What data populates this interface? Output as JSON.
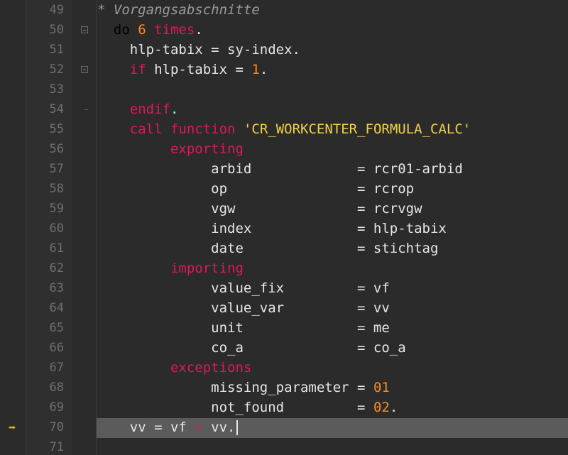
{
  "editor": {
    "current_line_arrow": "➡",
    "lines": [
      {
        "n": "49",
        "t": [
          {
            "c": "comment",
            "s": "* Vorgangsabschnitte"
          }
        ]
      },
      {
        "n": "50",
        "fold": "start",
        "t": [
          {
            "c": "plain",
            "s": "  "
          },
          {
            "c": "kw",
            "s": "do"
          },
          {
            "c": "plain",
            "s": " "
          },
          {
            "c": "num",
            "s": "6"
          },
          {
            "c": "plain",
            "s": " "
          },
          {
            "c": "kw2",
            "s": "times"
          },
          {
            "c": "plain",
            "s": "."
          }
        ]
      },
      {
        "n": "51",
        "t": [
          {
            "c": "plain",
            "s": "    hlp-tabix = sy-index."
          }
        ]
      },
      {
        "n": "52",
        "fold": "start",
        "t": [
          {
            "c": "plain",
            "s": "    "
          },
          {
            "c": "kw2",
            "s": "if"
          },
          {
            "c": "plain",
            "s": " hlp-tabix = "
          },
          {
            "c": "num",
            "s": "1"
          },
          {
            "c": "plain",
            "s": "."
          }
        ]
      },
      {
        "n": "53",
        "t": []
      },
      {
        "n": "54",
        "fold": "end",
        "t": [
          {
            "c": "plain",
            "s": "    "
          },
          {
            "c": "kw2",
            "s": "endif"
          },
          {
            "c": "plain",
            "s": "."
          }
        ]
      },
      {
        "n": "55",
        "t": [
          {
            "c": "plain",
            "s": "    "
          },
          {
            "c": "kw2",
            "s": "call function"
          },
          {
            "c": "plain",
            "s": " "
          },
          {
            "c": "str",
            "s": "'CR_WORKCENTER_FORMULA_CALC'"
          }
        ]
      },
      {
        "n": "56",
        "t": [
          {
            "c": "plain",
            "s": "         "
          },
          {
            "c": "kw2",
            "s": "exporting"
          }
        ]
      },
      {
        "n": "57",
        "t": [
          {
            "c": "plain",
            "s": "              arbid             = rcr01-arbid"
          }
        ]
      },
      {
        "n": "58",
        "t": [
          {
            "c": "plain",
            "s": "              op                = rcrop"
          }
        ]
      },
      {
        "n": "59",
        "t": [
          {
            "c": "plain",
            "s": "              vgw               = rcrvgw"
          }
        ]
      },
      {
        "n": "60",
        "t": [
          {
            "c": "plain",
            "s": "              index             = hlp-tabix"
          }
        ]
      },
      {
        "n": "61",
        "t": [
          {
            "c": "plain",
            "s": "              date              = stichtag"
          }
        ]
      },
      {
        "n": "62",
        "t": [
          {
            "c": "plain",
            "s": "         "
          },
          {
            "c": "kw2",
            "s": "importing"
          }
        ]
      },
      {
        "n": "63",
        "t": [
          {
            "c": "plain",
            "s": "              value_fix         = vf"
          }
        ]
      },
      {
        "n": "64",
        "t": [
          {
            "c": "plain",
            "s": "              value_var         = vv"
          }
        ]
      },
      {
        "n": "65",
        "t": [
          {
            "c": "plain",
            "s": "              unit              = me"
          }
        ]
      },
      {
        "n": "66",
        "t": [
          {
            "c": "plain",
            "s": "              co_a              = co_a"
          }
        ]
      },
      {
        "n": "67",
        "t": [
          {
            "c": "plain",
            "s": "         "
          },
          {
            "c": "kw2",
            "s": "exceptions"
          }
        ]
      },
      {
        "n": "68",
        "t": [
          {
            "c": "plain",
            "s": "              missing_parameter = "
          },
          {
            "c": "num",
            "s": "01"
          }
        ]
      },
      {
        "n": "69",
        "t": [
          {
            "c": "plain",
            "s": "              not_found         = "
          },
          {
            "c": "num",
            "s": "02"
          },
          {
            "c": "plain",
            "s": "."
          }
        ]
      },
      {
        "n": "70",
        "current": true,
        "t": [
          {
            "c": "plain",
            "s": "    vv = vf "
          },
          {
            "c": "kw2",
            "s": "+"
          },
          {
            "c": "plain",
            "s": " vv."
          }
        ]
      },
      {
        "n": "71",
        "t": []
      }
    ]
  },
  "colors": {
    "background": "#2b2b2b",
    "gutter": "#2f2f2f",
    "line_number": "#6f6f6f",
    "current_line_bg": "#5b5b5b",
    "plain": "#e6e6e6",
    "keyword_do": "#000000",
    "keyword": "#e3165b",
    "number": "#ff8a1f",
    "string": "#f2d249",
    "comment": "#9a9a9a",
    "arrow": "#f0b41c"
  }
}
